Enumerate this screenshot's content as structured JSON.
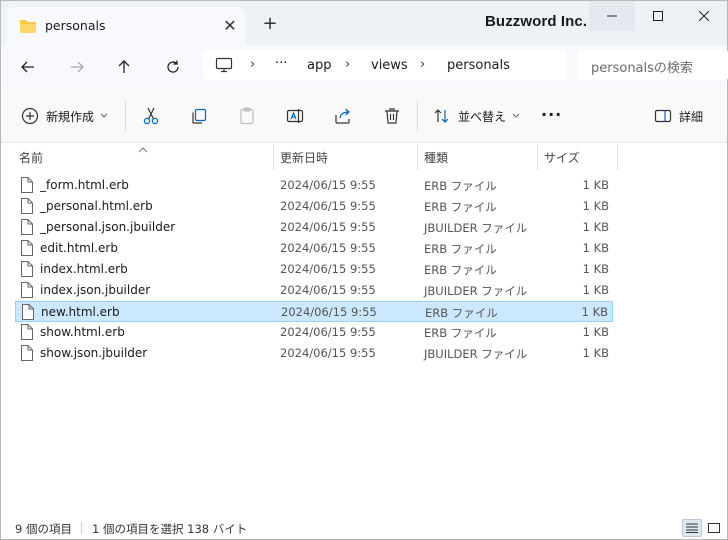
{
  "titlebar": {
    "tab_label": "personals",
    "tab_close_glyph": "✕",
    "new_tab_glyph": "+",
    "brand": "Buzzword Inc."
  },
  "nav": {
    "breadcrumb": [
      "app",
      "views",
      "personals"
    ],
    "overflow_glyph": "···",
    "separator_glyph": "›",
    "search_placeholder": "personalsの検索"
  },
  "toolbar": {
    "new_label": "新規作成",
    "sort_label": "並べ替え",
    "more_glyph": "···",
    "details_label": "詳細"
  },
  "columns": {
    "name": "名前",
    "modified": "更新日時",
    "type": "種類",
    "size": "サイズ"
  },
  "files": [
    {
      "name": "_form.html.erb",
      "modified": "2024/06/15 9:55",
      "type": "ERB ファイル",
      "size": "1 KB"
    },
    {
      "name": "_personal.html.erb",
      "modified": "2024/06/15 9:55",
      "type": "ERB ファイル",
      "size": "1 KB"
    },
    {
      "name": "_personal.json.jbuilder",
      "modified": "2024/06/15 9:55",
      "type": "JBUILDER ファイル",
      "size": "1 KB"
    },
    {
      "name": "edit.html.erb",
      "modified": "2024/06/15 9:55",
      "type": "ERB ファイル",
      "size": "1 KB"
    },
    {
      "name": "index.html.erb",
      "modified": "2024/06/15 9:55",
      "type": "ERB ファイル",
      "size": "1 KB"
    },
    {
      "name": "index.json.jbuilder",
      "modified": "2024/06/15 9:55",
      "type": "JBUILDER ファイル",
      "size": "1 KB"
    },
    {
      "name": "new.html.erb",
      "modified": "2024/06/15 9:55",
      "type": "ERB ファイル",
      "size": "1 KB"
    },
    {
      "name": "show.html.erb",
      "modified": "2024/06/15 9:55",
      "type": "ERB ファイル",
      "size": "1 KB"
    },
    {
      "name": "show.json.jbuilder",
      "modified": "2024/06/15 9:55",
      "type": "JBUILDER ファイル",
      "size": "1 KB"
    }
  ],
  "status": {
    "item_count": "9 個の項目",
    "selection": "1 個の項目を選択  138 バイト"
  },
  "colors": {
    "selection_bg": "#cce8ff",
    "selection_border": "#99d1ff",
    "accent": "#0067c0",
    "folder": "#f8c84a"
  }
}
